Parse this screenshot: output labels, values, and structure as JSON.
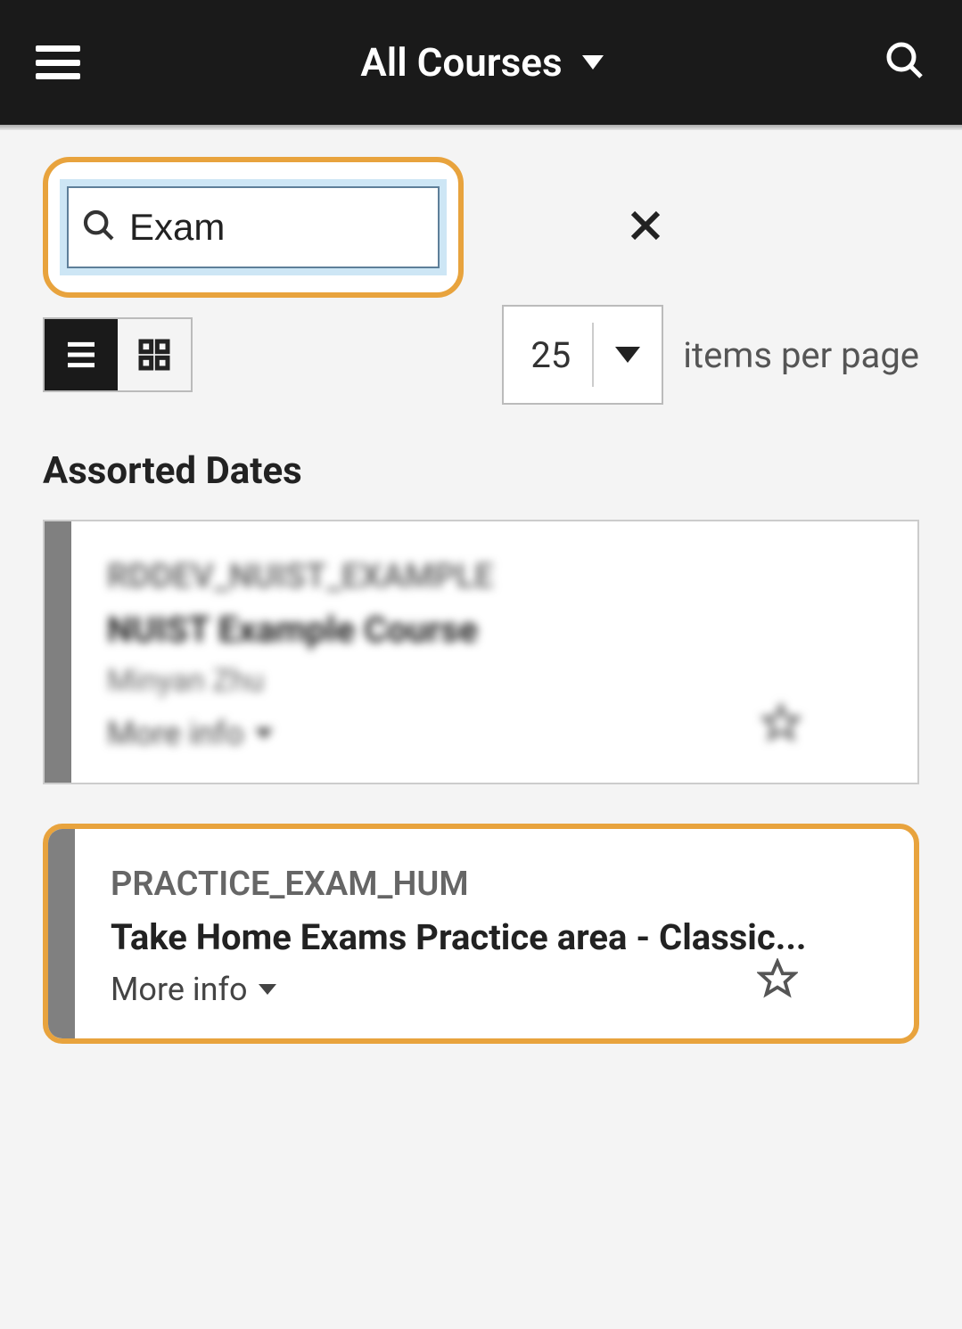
{
  "header": {
    "title": "All Courses"
  },
  "search": {
    "value": "Exam"
  },
  "pagination": {
    "per_page": "25",
    "label": "items per page"
  },
  "section": {
    "title": "Assorted Dates"
  },
  "courses": [
    {
      "code": "RDDEV_NUIST_EXAMPLE",
      "title": "NUIST Example Course",
      "instructor": "Minyan Zhu",
      "more_info": "More info"
    },
    {
      "code": "PRACTICE_EXAM_HUM",
      "title": "Take Home Exams Practice area - Classic...",
      "more_info": "More info"
    }
  ]
}
